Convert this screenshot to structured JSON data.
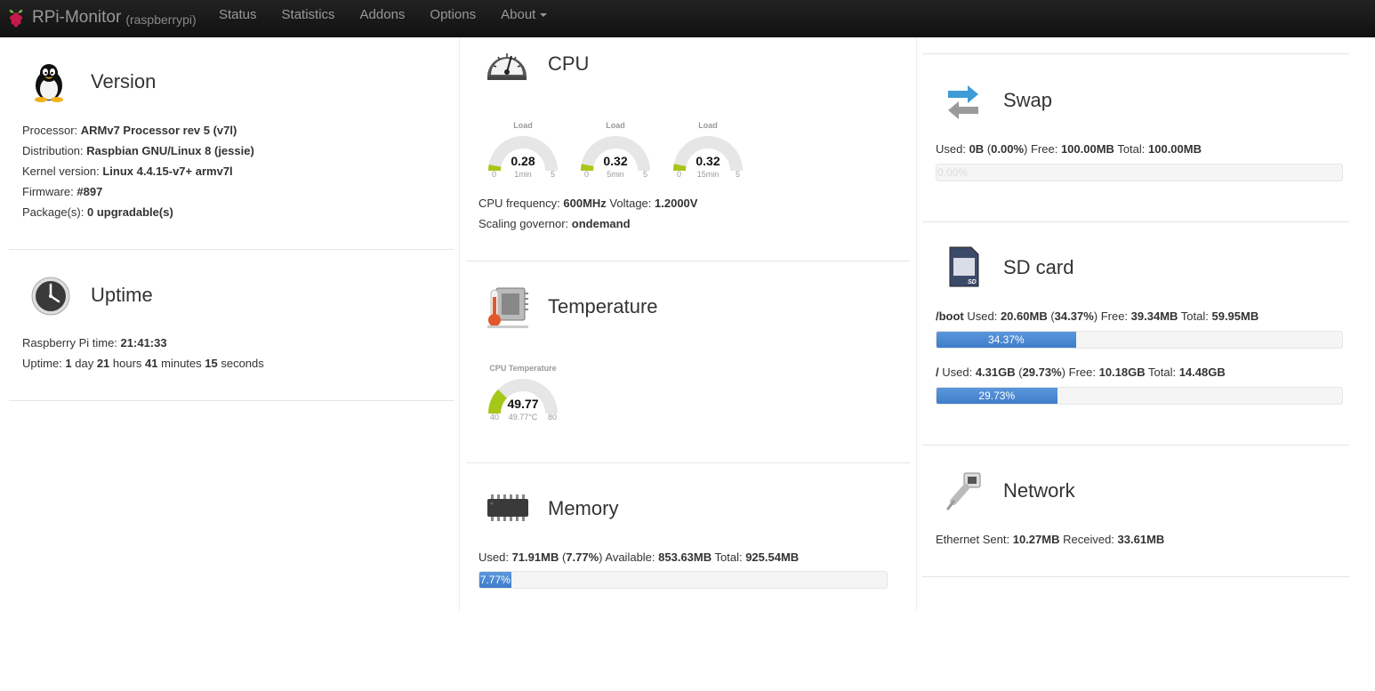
{
  "navbar": {
    "brand": "RPi-Monitor",
    "host": "(raspberrypi)",
    "items": [
      {
        "label": "Status"
      },
      {
        "label": "Statistics"
      },
      {
        "label": "Addons"
      },
      {
        "label": "Options"
      },
      {
        "label": "About"
      }
    ]
  },
  "version": {
    "title": "Version",
    "rows": [
      {
        "label": "Processor: ",
        "value": "ARMv7 Processor rev 5 (v7l)"
      },
      {
        "label": "Distribution: ",
        "value": "Raspbian GNU/Linux 8 (jessie)"
      },
      {
        "label": "Kernel version: ",
        "value": "Linux 4.4.15-v7+ armv7l"
      },
      {
        "label": "Firmware: ",
        "value": "#897"
      },
      {
        "label": "Package(s): ",
        "value": "0 upgradable(s)"
      }
    ]
  },
  "uptime": {
    "title": "Uptime",
    "pi_time_label": "Raspberry Pi time: ",
    "pi_time": "21:41:33",
    "uptime_label": "Uptime: ",
    "days": "1",
    "days_unit": " day ",
    "hours": "21",
    "hours_unit": " hours ",
    "minutes": "41",
    "minutes_unit": " minutes ",
    "seconds": "15",
    "seconds_unit": " seconds"
  },
  "cpu": {
    "title": "CPU",
    "gauges": [
      {
        "label": "Load",
        "value": "0.28",
        "min": "0",
        "max": "5",
        "sub": "1min",
        "fraction": 0.056
      },
      {
        "label": "Load",
        "value": "0.32",
        "min": "0",
        "max": "5",
        "sub": "5min",
        "fraction": 0.064
      },
      {
        "label": "Load",
        "value": "0.32",
        "min": "0",
        "max": "5",
        "sub": "15min",
        "fraction": 0.064
      }
    ],
    "freq_label": "CPU frequency: ",
    "freq": "600MHz",
    "voltage_label": " Voltage: ",
    "voltage": "1.2000V",
    "governor_label": "Scaling governor: ",
    "governor": "ondemand"
  },
  "temperature": {
    "title": "Temperature",
    "gauge": {
      "label": "CPU Temperature",
      "value": "49.77",
      "min": "40",
      "max": "80",
      "sub": "49.77°C",
      "fraction": 0.244
    }
  },
  "memory": {
    "title": "Memory",
    "used_label": "Used: ",
    "used": "71.91MB",
    "pct_open": " (",
    "pct": "7.77%",
    "pct_close": ")",
    "avail_label": " Available: ",
    "avail": "853.63MB",
    "total_label": " Total: ",
    "total": "925.54MB",
    "bar_label": "7.77%",
    "fraction": 0.0777
  },
  "swap": {
    "title": "Swap",
    "used_label": "Used: ",
    "used": "0B",
    "pct_open": " (",
    "pct": "0.00%",
    "pct_close": ")",
    "free_label": " Free: ",
    "free": "100.00MB",
    "total_label": " Total: ",
    "total": "100.00MB",
    "bar_label": "0.00%",
    "fraction": 0
  },
  "sdcard": {
    "title": "SD card",
    "boot": {
      "mount": "/boot",
      "used_label": " Used: ",
      "used": "20.60MB",
      "pct_open": " (",
      "pct": "34.37%",
      "pct_close": ")",
      "free_label": " Free: ",
      "free": "39.34MB",
      "total_label": " Total: ",
      "total": "59.95MB",
      "bar_label": "34.37%",
      "fraction": 0.3437
    },
    "root": {
      "mount": "/",
      "used_label": " Used: ",
      "used": "4.31GB",
      "pct_open": " (",
      "pct": "29.73%",
      "pct_close": ")",
      "free_label": " Free: ",
      "free": "10.18GB",
      "total_label": " Total: ",
      "total": "14.48GB",
      "bar_label": "29.73%",
      "fraction": 0.2973
    }
  },
  "network": {
    "title": "Network",
    "sent_label": "Ethernet Sent: ",
    "sent": "10.27MB",
    "recv_label": " Received: ",
    "recv": "33.61MB"
  },
  "colors": {
    "navbar_bg": "#1b1b1b",
    "progress_bar": "#4a8ad4",
    "gauge_fill": "#a6c718",
    "gauge_track": "#e6e6e6"
  }
}
